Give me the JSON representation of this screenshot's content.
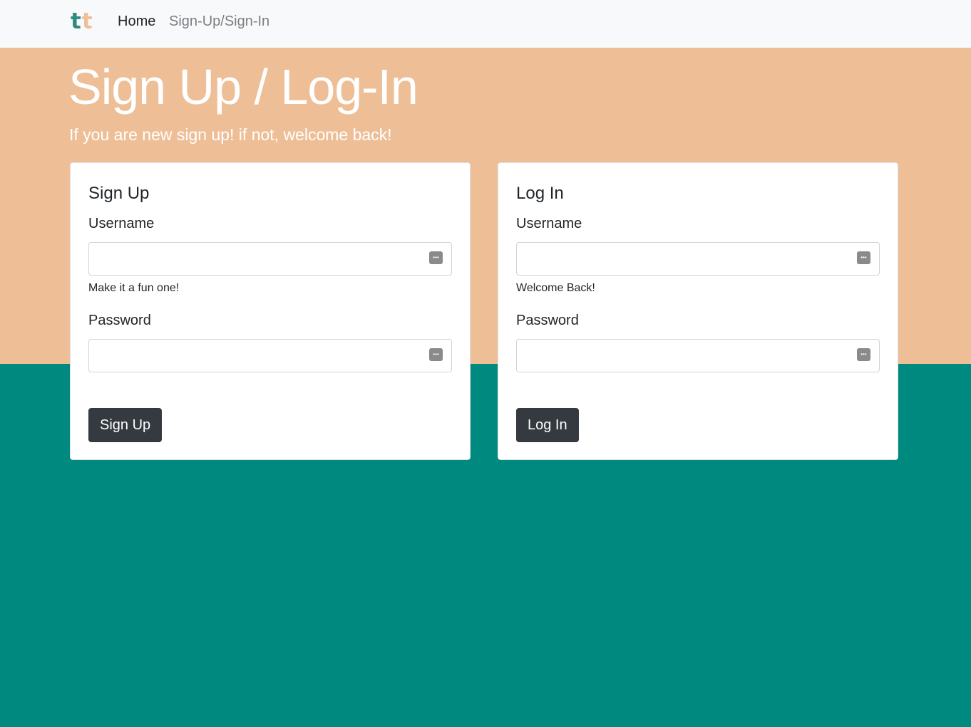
{
  "nav": {
    "brand_letter_1": "t",
    "brand_letter_2": "t",
    "links": [
      "Home",
      "Sign-Up/Sign-In"
    ]
  },
  "hero": {
    "title": "Sign Up / Log-In",
    "subtitle": "If you are new sign up! if not, welcome back!"
  },
  "signup": {
    "title": "Sign Up",
    "username_label": "Username",
    "username_value": "",
    "username_help": "Make it a fun one!",
    "password_label": "Password",
    "password_value": "",
    "button": "Sign Up"
  },
  "login": {
    "title": "Log In",
    "username_label": "Username",
    "username_value": "",
    "username_help": "Welcome Back!",
    "password_label": "Password",
    "password_value": "",
    "button": "Log In"
  },
  "icons": {
    "field_icon": "password-manager-key-icon"
  },
  "colors": {
    "hero_bg": "#eebf97",
    "page_bg": "#00897f",
    "navbar_bg": "#f8f9fa",
    "button_bg": "#343a40",
    "brand_t1": "#2f8a82",
    "brand_t2": "#efbf97"
  }
}
